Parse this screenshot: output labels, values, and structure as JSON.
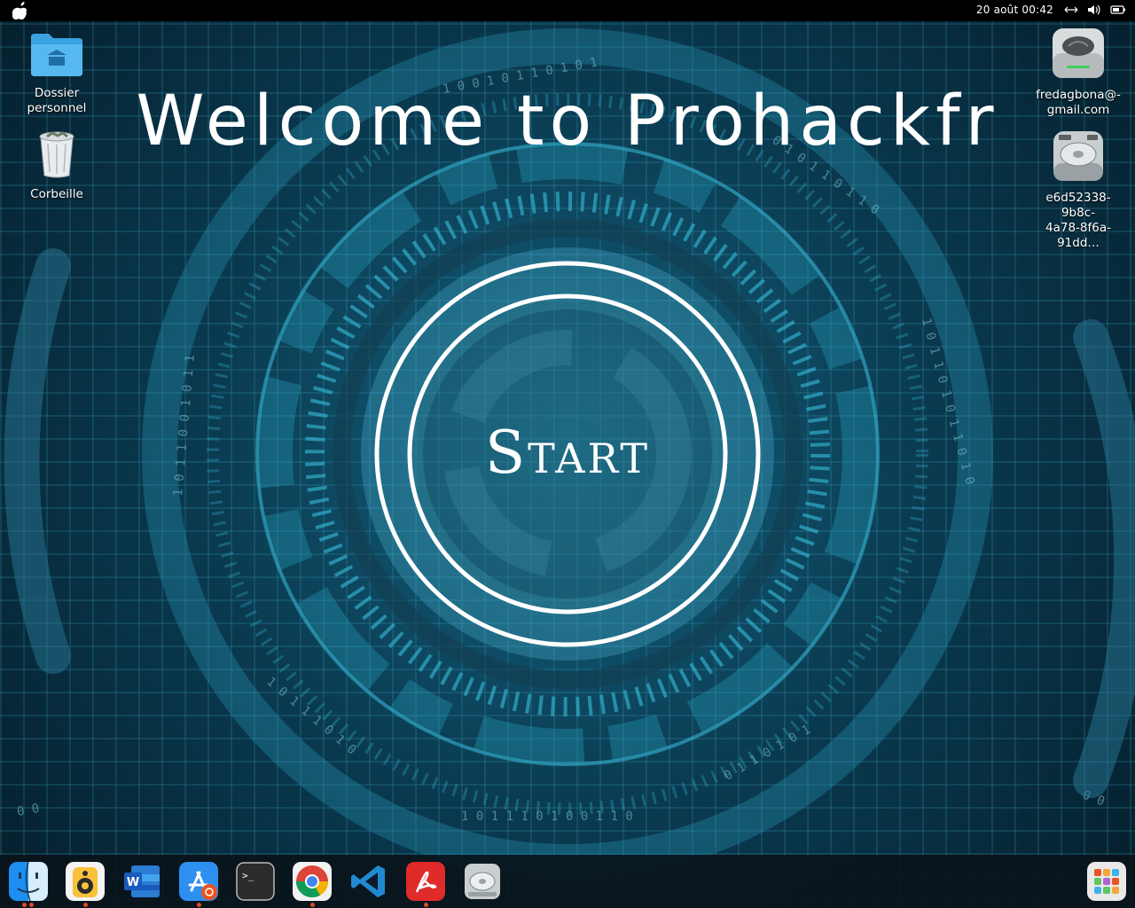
{
  "menubar": {
    "clock": "20 août  00:42",
    "icons": [
      "apple-icon",
      "network-icon",
      "volume-icon",
      "battery-icon"
    ]
  },
  "desktop": {
    "left_icons": [
      {
        "label_line1": "Dossier",
        "label_line2": "personnel",
        "icon": "home-folder-icon"
      },
      {
        "label_line1": "Corbeille",
        "label_line2": "",
        "icon": "trash-icon"
      }
    ],
    "right_icons": [
      {
        "label_line1": "fredagbona@-",
        "label_line2": "gmail.com",
        "icon": "network-drive-icon"
      },
      {
        "label_line1": "e6d52338-9b8c-",
        "label_line2": "4a78-8f6a-91dd…",
        "icon": "disk-drive-icon"
      }
    ]
  },
  "hero": {
    "title": "Welcome to Prohackfr",
    "start_label": "Start"
  },
  "dock": {
    "items": [
      {
        "name": "finder-icon",
        "running": true
      },
      {
        "name": "rhythmbox-icon",
        "running": true
      },
      {
        "name": "word-icon",
        "running": false
      },
      {
        "name": "software-center-icon",
        "running": true
      },
      {
        "name": "terminal-icon",
        "running": false
      },
      {
        "name": "chrome-icon",
        "running": true
      },
      {
        "name": "vscode-icon",
        "running": false
      },
      {
        "name": "pdf-reader-icon",
        "running": true
      },
      {
        "name": "disk-utility-icon",
        "running": false
      },
      {
        "name": "app-grid-icon",
        "running": false
      }
    ]
  },
  "colors": {
    "accent": "#29b6d6",
    "background": "#0a3a50",
    "dock": "#0a141a"
  }
}
